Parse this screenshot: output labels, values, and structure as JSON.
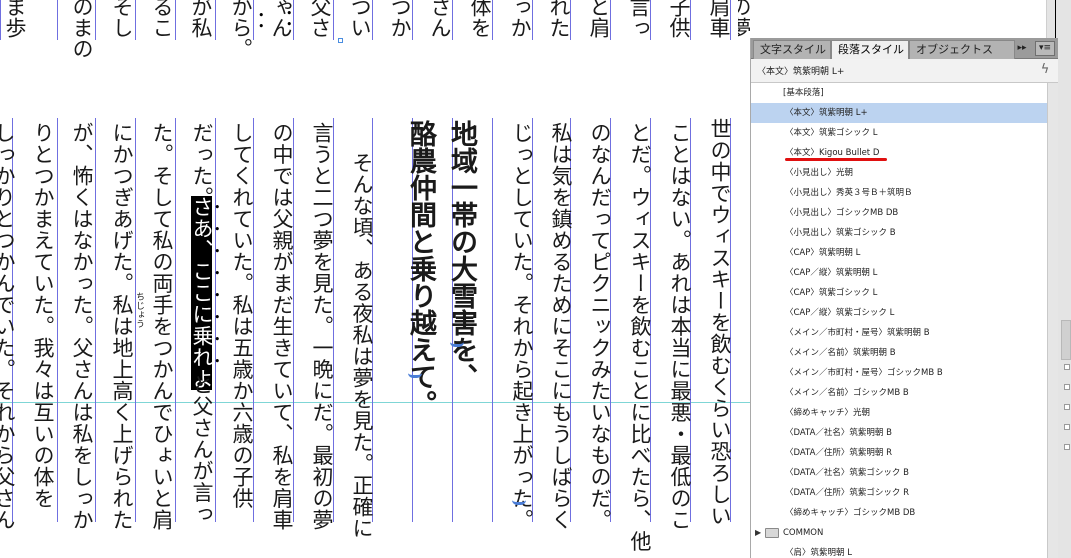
{
  "document": {
    "top_row_columns": [
      "ま歩",
      "のまの",
      "そし",
      "るこ",
      "が私",
      "から。",
      "ゃん",
      "父さ",
      "つい",
      "つか",
      "さん",
      "体を",
      "っか",
      "れた",
      "と肩",
      "言っ",
      "子供",
      "肩車",
      "の夢",
      "確に"
    ],
    "main_columns": [
      "世の中でウィスキーを飲むくらい恐ろしい",
      "ことはない。あれは本当に最悪・最低のこ",
      "とだ。ウィスキーを飲むことに比べたら、他",
      "のなんだってピクニックみたいなものだ。",
      "私は気を鎮めるためにそこにもうしばらく",
      "じっとしていた。それから起き上がった。",
      "地域一帯の大雪害を、",
      "酪農仲間と乗り越えて。",
      "そんな頃、ある夜私は夢を見た。正確に",
      "言うと二つ夢を見た。一晩にだ。最初の夢",
      "の中では父親がまだ生きていて、私を肩車",
      "してくれていた。私は五歳か六歳の子供",
      "だった。",
      "さあ、ここに乗れよ",
      "と父さんが言っ",
      "た。そして私の両手をつかんでひょいと肩",
      "にかつぎあげた。私は地上高く上げられた",
      "が、怖くはなかった。父さんは私をしっか",
      "りとつかまえていた。我々は互いの体を",
      "しっかりとつかんでいた。それから父さん"
    ],
    "ruby": "ちじょう"
  },
  "panel": {
    "tabs": [
      "文字スタイル",
      "段落スタイル",
      "オブジェクトス"
    ],
    "collapse_glyph": "▸▸",
    "menu_glyph": "▾≡",
    "current_style": "〈本文〉筑紫明朝 L+",
    "lightning_glyph": "ϟ",
    "styles": [
      "[基本段落]",
      "〈本文〉筑紫明朝 L+",
      "〈本文〉筑紫ゴシック L",
      "〈本文〉Kigou Bullet D",
      "〈小見出し〉光朝",
      "〈小見出し〉秀英３号Ｂ＋筑明Ｂ",
      "〈小見出し〉ゴシックMB DB",
      "〈小見出し〉筑紫ゴシック B",
      "〈CAP〉筑紫明朝 L",
      "〈CAP／縦〉筑紫明朝 L",
      "〈CAP〉筑紫ゴシック L",
      "〈CAP／縦〉筑紫ゴシック L",
      "〈メイン／市町村・屋号〉筑紫明朝 B",
      "〈メイン／名前〉筑紫明朝 B",
      "〈メイン／市町村・屋号〉ゴシックMB B",
      "〈メイン／名前〉ゴシックMB B",
      "〈締めキャッチ〉光朝",
      "〈DATA／社名〉筑紫明朝 B",
      "〈DATA／住所〉筑紫明朝 R",
      "〈DATA／社名〉筑紫ゴシック B",
      "〈DATA／住所〉筑紫ゴシック R",
      "〈締めキャッチ〉ゴシックMB DB",
      "COMMON",
      "〈肩〉筑紫明朝 L"
    ],
    "selected_style": "〈本文〉筑紫明朝 L+",
    "highlight_color": "#bcd3f0",
    "underline_color": "#e01010"
  }
}
